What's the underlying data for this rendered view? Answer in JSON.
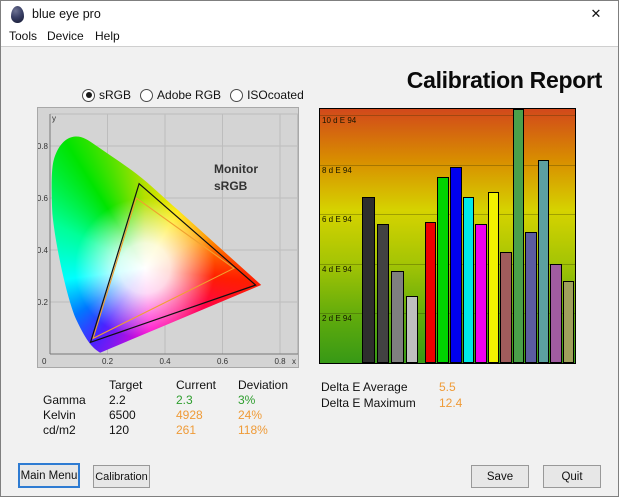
{
  "window": {
    "title": "blue eye pro",
    "close_glyph": "✕"
  },
  "menu": {
    "items": [
      "Tools",
      "Device",
      "Help"
    ]
  },
  "report_title": "Calibration Report",
  "color_space_options": [
    {
      "label": "sRGB",
      "selected": true
    },
    {
      "label": "Adobe RGB",
      "selected": false
    },
    {
      "label": "ISOcoated",
      "selected": false
    }
  ],
  "chart_data": [
    {
      "type": "scatter",
      "name": "cie-1931-chromaticity-gamut-comparison",
      "xlabel": "x",
      "ylabel": "y",
      "xlim": [
        0,
        0.86
      ],
      "ylim": [
        0,
        0.92
      ],
      "x_ticks": [
        "0",
        "0.2",
        "0.4",
        "0.6",
        "0.8"
      ],
      "y_ticks": [
        "0.2",
        "0.4",
        "0.6",
        "0.8"
      ],
      "grid": true,
      "series": [
        {
          "name": "Monitor",
          "color": "#111111",
          "points": [
            [
              0.715,
              0.265
            ],
            [
              0.31,
              0.655
            ],
            [
              0.141,
              0.045
            ]
          ]
        },
        {
          "name": "sRGB",
          "color": "#f0a030",
          "points": [
            [
              0.64,
              0.33
            ],
            [
              0.3,
              0.6
            ],
            [
              0.15,
              0.06
            ]
          ]
        }
      ]
    },
    {
      "type": "bar",
      "name": "delta-e94-per-test-patch",
      "ylabel": "dE94",
      "ylim": [
        0,
        10.25
      ],
      "grid": true,
      "gridlines": [
        {
          "value": 10,
          "label": "10 d E 94"
        },
        {
          "value": 8,
          "label": "8 d E 94"
        },
        {
          "value": 6,
          "label": "6 d E 94"
        },
        {
          "value": 4,
          "label": "4 d E 94"
        },
        {
          "value": 2,
          "label": "2 d E 94"
        }
      ],
      "bars": [
        {
          "name": "gray-dark",
          "color": "#2e2e2e",
          "value": 6.7
        },
        {
          "name": "gray-70",
          "color": "#424242",
          "value": 5.6
        },
        {
          "name": "gray-50",
          "color": "#7f7f7f",
          "value": 3.7
        },
        {
          "name": "gray-25",
          "color": "#bfbfbf",
          "value": 2.7
        },
        {
          "name": "red",
          "color": "#ee0000",
          "value": 5.7
        },
        {
          "name": "green",
          "color": "#00d400",
          "value": 7.5
        },
        {
          "name": "blue",
          "color": "#0000ee",
          "value": 7.9
        },
        {
          "name": "cyan",
          "color": "#00e8e8",
          "value": 6.7
        },
        {
          "name": "magenta",
          "color": "#ee00ee",
          "value": 5.6
        },
        {
          "name": "yellow",
          "color": "#f2f200",
          "value": 6.9
        },
        {
          "name": "brown",
          "color": "#a05c5c",
          "value": 4.5
        },
        {
          "name": "mid-green",
          "color": "#4aa04a",
          "value": 12.4
        },
        {
          "name": "slate-blue",
          "color": "#5c5ca0",
          "value": 5.3
        },
        {
          "name": "teal",
          "color": "#5ca0a0",
          "value": 8.2
        },
        {
          "name": "purple",
          "color": "#a05ca0",
          "value": 4.0
        },
        {
          "name": "olive",
          "color": "#a0a05c",
          "value": 3.3
        }
      ]
    }
  ],
  "results_table": {
    "headers": [
      "",
      "Target",
      "Current",
      "Deviation"
    ],
    "rows": [
      {
        "label": "Gamma",
        "target": "2.2",
        "current": "2.3",
        "deviation": "3%",
        "status_color": "#2f9e2f"
      },
      {
        "label": "Kelvin",
        "target": "6500",
        "current": "4928",
        "deviation": "24%",
        "status_color": "#ef9b38"
      },
      {
        "label": "cd/m2",
        "target": "120",
        "current": "261",
        "deviation": "118%",
        "status_color": "#ef9b38"
      }
    ]
  },
  "delta_e": {
    "average_label": "Delta E Average",
    "average_value": "5.5",
    "maximum_label": "Delta E Maximum",
    "maximum_value": "12.4",
    "value_color": "#ef9b38"
  },
  "buttons": {
    "main_menu": "Main Menu",
    "calibration": "Calibration",
    "save": "Save",
    "quit": "Quit"
  },
  "accent_colors": {
    "srgb_overlay": "#f0a030",
    "ok_green": "#2f9e2f",
    "warn_orange": "#ef9b38",
    "focus_blue": "#2e7bd2"
  }
}
